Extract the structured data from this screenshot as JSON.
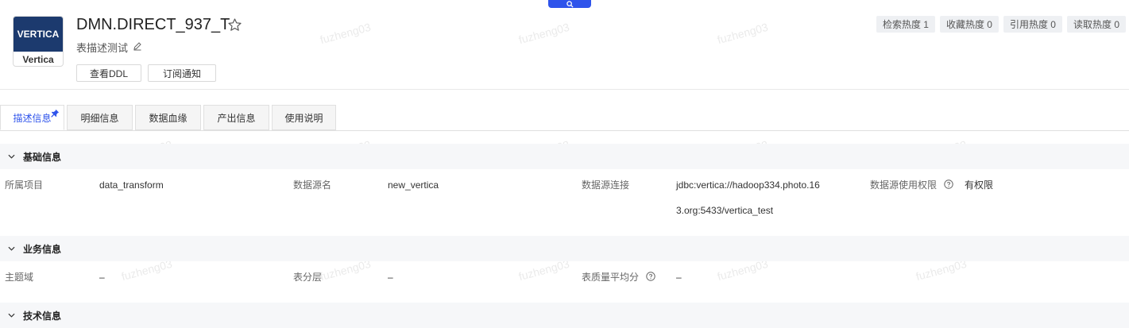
{
  "header": {
    "title": "DMN.DIRECT_937_T",
    "description": "表描述测试",
    "logo_top": "VERTICA",
    "logo_bottom": "Vertica",
    "buttons": [
      "查看DDL",
      "订阅通知"
    ],
    "heat": [
      "检索热度 1",
      "收藏热度 0",
      "引用热度 0",
      "读取热度 0"
    ]
  },
  "tabs": [
    "描述信息",
    "明细信息",
    "数据血缘",
    "产出信息",
    "使用说明"
  ],
  "sections": {
    "basic": {
      "title": "基础信息",
      "project_label": "所属项目",
      "project_value": "data_transform",
      "source_name_label": "数据源名",
      "source_name_value": "new_vertica",
      "source_conn_label": "数据源连接",
      "source_conn_value_line1": "jdbc:vertica://hadoop334.photo.16",
      "source_conn_value_line2": "3.org:5433/vertica_test",
      "permission_label": "数据源使用权限",
      "permission_value": "有权限"
    },
    "business": {
      "title": "业务信息",
      "domain_label": "主题域",
      "domain_value": "–",
      "layer_label": "表分层",
      "layer_value": "–",
      "quality_label": "表质量平均分",
      "quality_value": "–"
    },
    "tech": {
      "title": "技术信息"
    }
  },
  "watermark": "fuzheng03",
  "colors": {
    "accent": "#2f54eb",
    "logo_bg": "#1c3a6e"
  }
}
